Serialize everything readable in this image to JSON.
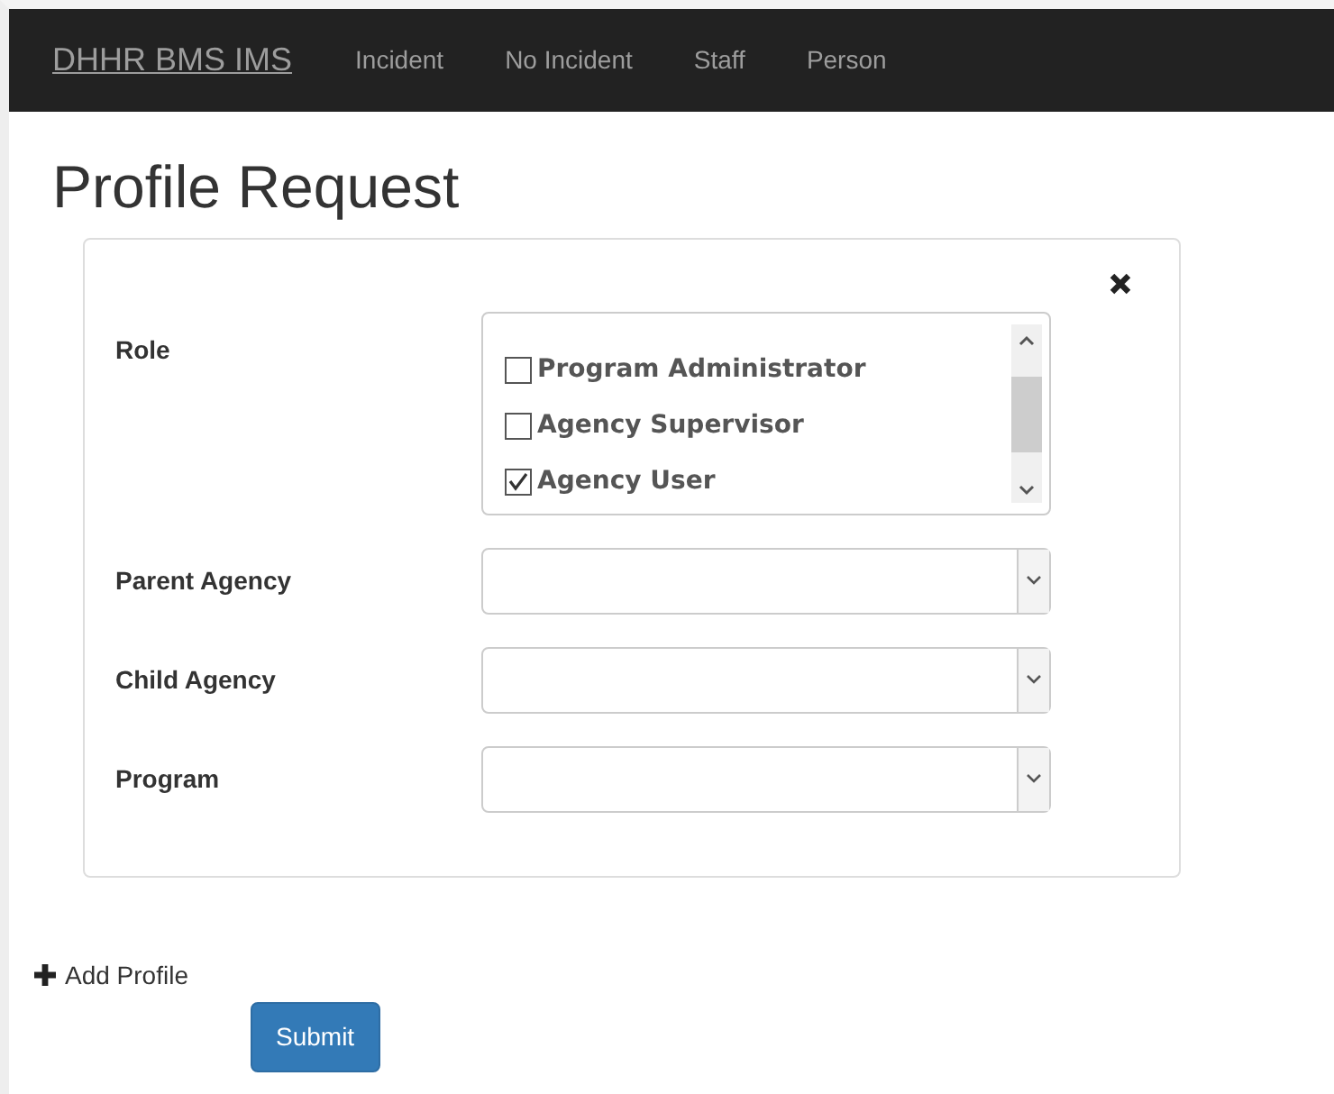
{
  "navbar": {
    "brand": "DHHR BMS IMS",
    "links": [
      {
        "label": "Incident"
      },
      {
        "label": "No Incident"
      },
      {
        "label": "Staff"
      },
      {
        "label": "Person"
      }
    ]
  },
  "title": "Profile Request",
  "form": {
    "role": {
      "label": "Role",
      "options": [
        {
          "label": "Program Administrator",
          "checked": false
        },
        {
          "label": "Agency Supervisor",
          "checked": false
        },
        {
          "label": "Agency User",
          "checked": true
        }
      ]
    },
    "selects": [
      {
        "label": "Parent Agency"
      },
      {
        "label": "Child Agency"
      },
      {
        "label": "Program"
      }
    ]
  },
  "add_profile": "Add Profile",
  "submit": "Submit"
}
